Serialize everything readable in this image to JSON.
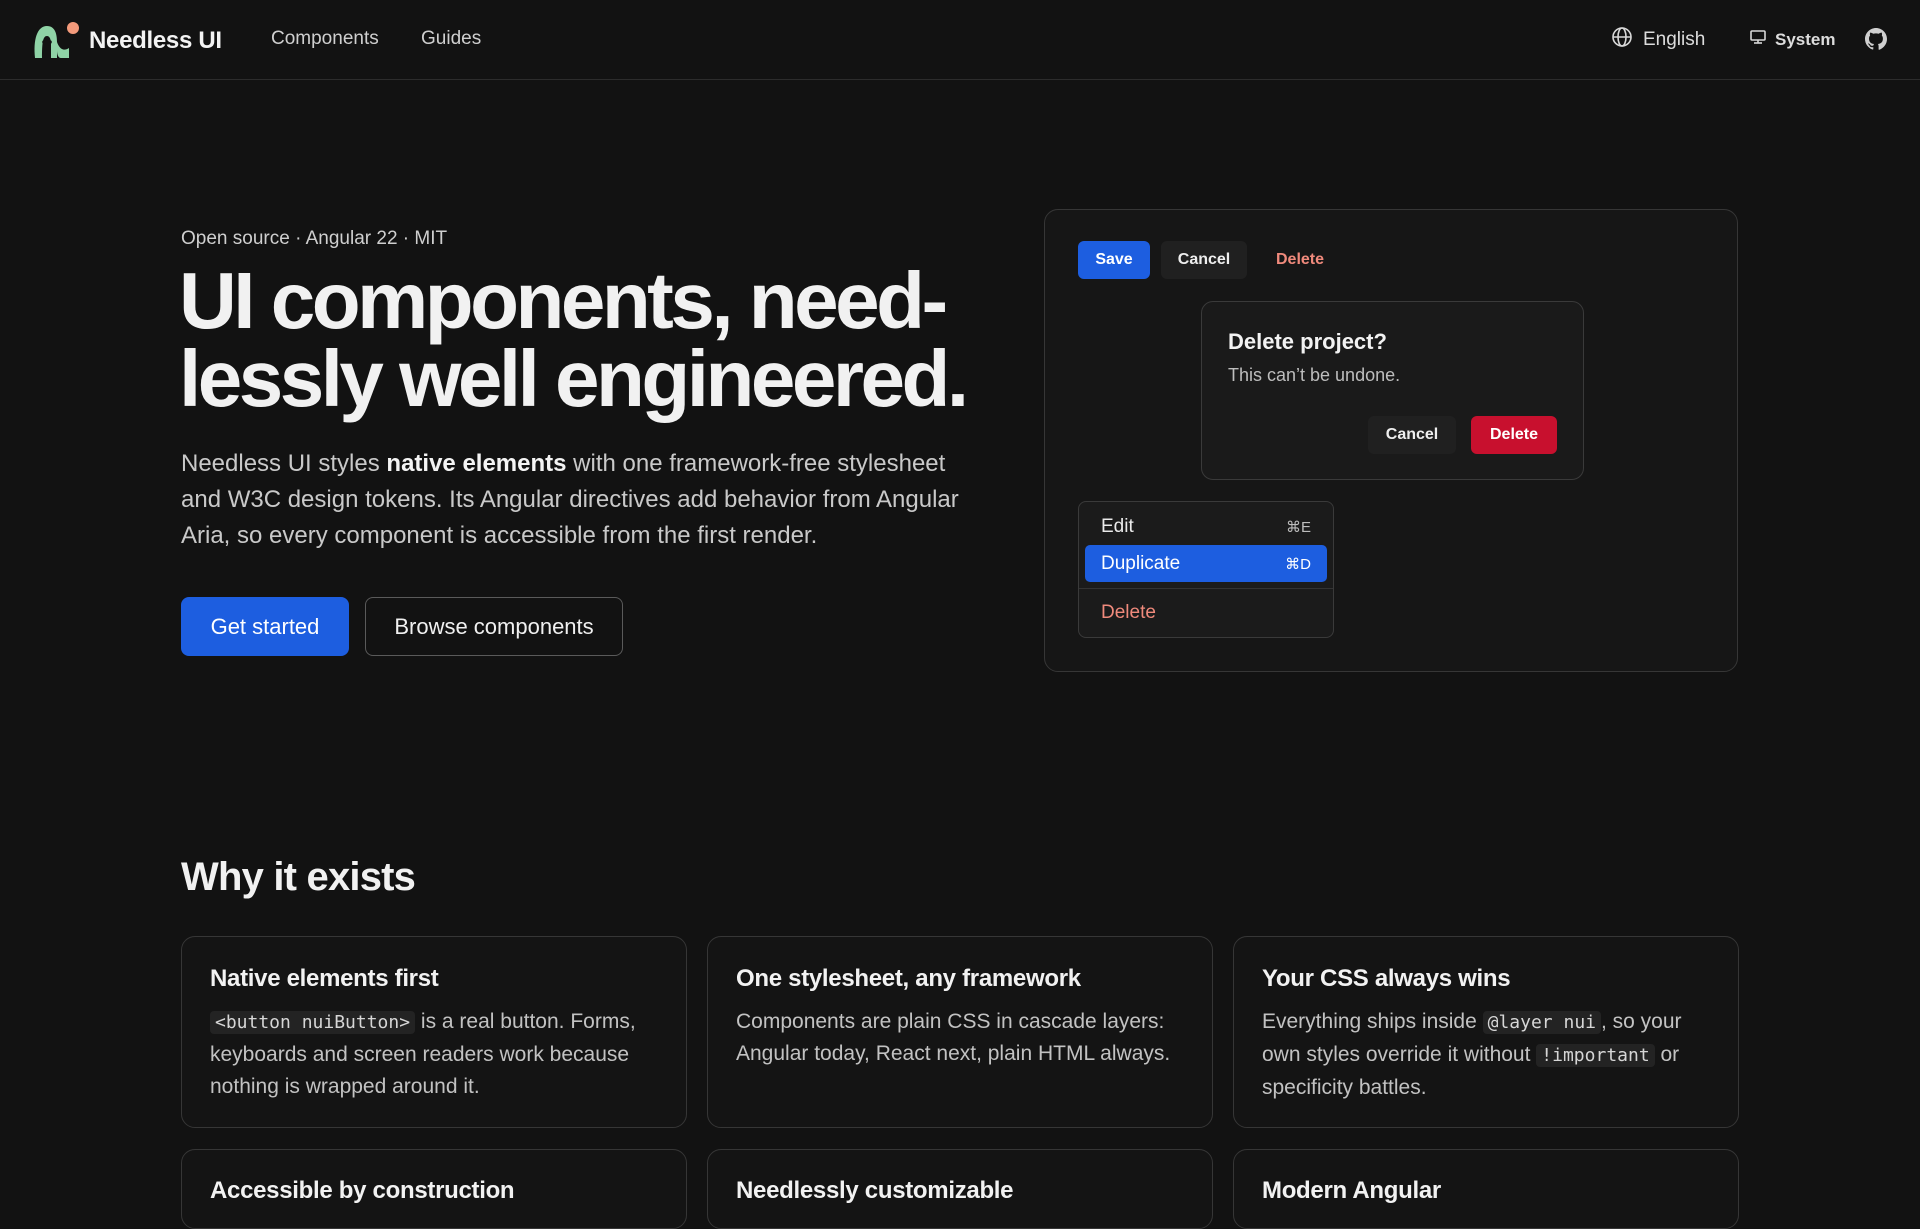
{
  "nav": {
    "brand": "Needless UI",
    "links": [
      "Components",
      "Guides"
    ],
    "language": "English",
    "theme": "System"
  },
  "hero": {
    "eyebrow": "Open source · Angular 22 · MIT",
    "title_line1": "UI components, need-",
    "title_line2": "lessly well engineered.",
    "sub_part1": "Needless UI styles ",
    "sub_bold": "native elements",
    "sub_part2": " with one framework-free stylesheet and W3C design tokens. Its Angular directives add behavior from Angular Aria, so every component is accessible from the first render.",
    "cta_primary": "Get started",
    "cta_secondary": "Browse components"
  },
  "demo": {
    "toolbar": {
      "save": "Save",
      "cancel": "Cancel",
      "delete": "Delete"
    },
    "dialog": {
      "title": "Delete project?",
      "body": "This can’t be undone.",
      "cancel": "Cancel",
      "confirm": "Delete"
    },
    "menu": {
      "items": [
        {
          "label": "Edit",
          "shortcut": "⌘E"
        },
        {
          "label": "Duplicate",
          "shortcut": "⌘D"
        },
        {
          "label": "Delete",
          "shortcut": ""
        }
      ]
    }
  },
  "why": {
    "title": "Why it exists",
    "cards": [
      {
        "title": "Native elements first",
        "code1": "<button nuiButton>",
        "text1": " is a real button. Forms, keyboards and screen readers work because nothing is wrapped around it."
      },
      {
        "title": "One stylesheet, any framework",
        "text1": "Components are plain CSS in cascade layers: Angular today, React next, plain HTML always."
      },
      {
        "title": "Your CSS always wins",
        "text1": "Everything ships inside ",
        "code1": "@layer nui",
        "text2": ", so your own styles override it without ",
        "code2": "!important",
        "text3": " or specificity battles."
      },
      {
        "title": "Accessible by construction"
      },
      {
        "title": "Needlessly customizable"
      },
      {
        "title": "Modern Angular"
      }
    ]
  },
  "colors": {
    "background": "#121212",
    "accent": "#1d5ee0",
    "danger": "#c8102e",
    "danger_text": "#f08a7c",
    "logo_green": "#8fd3a6",
    "logo_orange": "#f39a7b"
  }
}
